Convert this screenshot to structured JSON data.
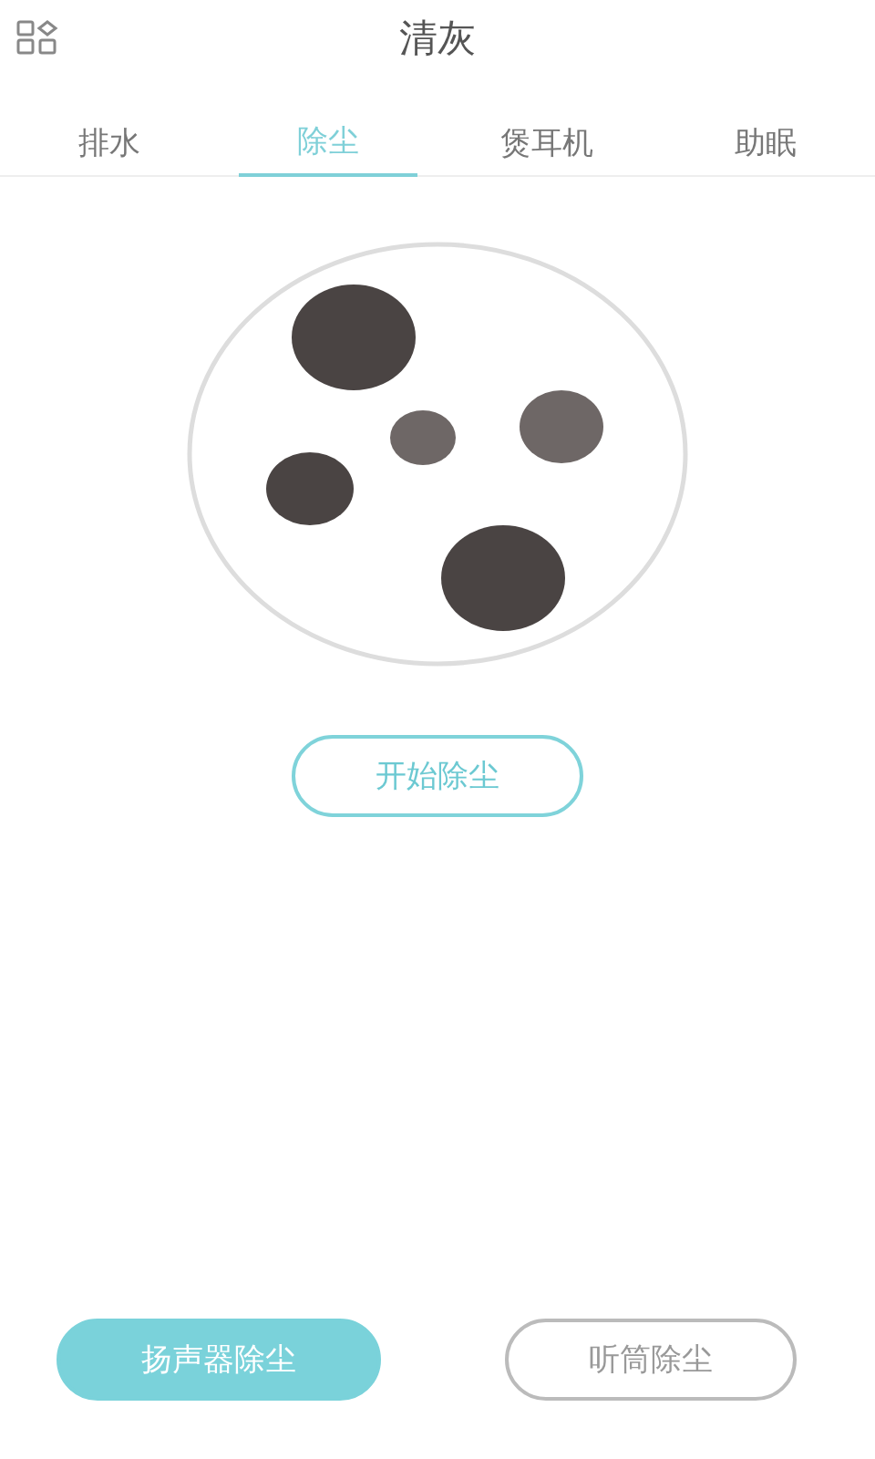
{
  "header": {
    "title": "清灰"
  },
  "tabs": [
    {
      "label": "排水",
      "selected": false
    },
    {
      "label": "除尘",
      "selected": true
    },
    {
      "label": "煲耳机",
      "selected": false
    },
    {
      "label": "助眠",
      "selected": false
    }
  ],
  "start_button": {
    "label": "开始除尘"
  },
  "modes": [
    {
      "label": "扬声器除尘",
      "selected": true
    },
    {
      "label": "听筒除尘",
      "selected": false
    }
  ]
}
